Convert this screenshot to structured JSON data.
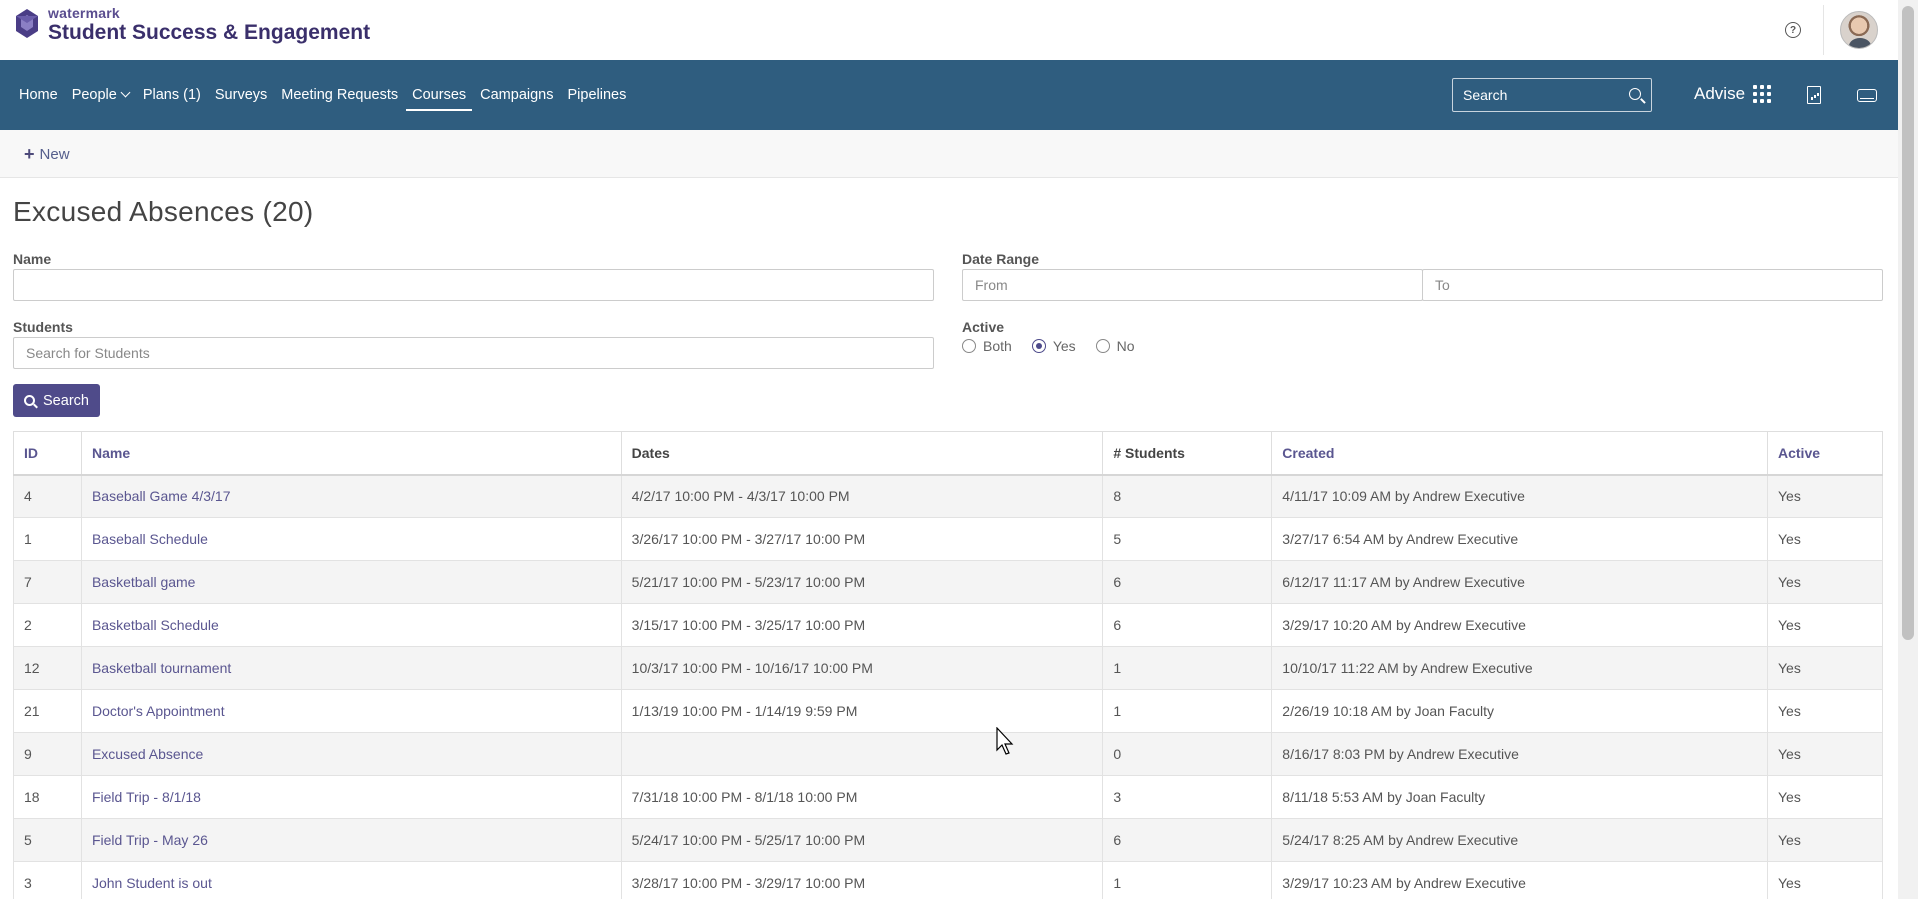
{
  "brand": {
    "small": "watermark",
    "large": "Student Success & Engagement"
  },
  "nav": {
    "items": [
      {
        "label": "Home"
      },
      {
        "label": "People"
      },
      {
        "label": "Plans (1)"
      },
      {
        "label": "Surveys"
      },
      {
        "label": "Meeting Requests"
      },
      {
        "label": "Courses"
      },
      {
        "label": "Campaigns"
      },
      {
        "label": "Pipelines"
      }
    ],
    "active": "Courses",
    "search_placeholder": "Search",
    "advise_label": "Advise"
  },
  "actions": {
    "new_label": "New"
  },
  "page": {
    "title": "Excused Absences (20)"
  },
  "filters": {
    "name_label": "Name",
    "name_value": "",
    "date_range_label": "Date Range",
    "from_placeholder": "From",
    "to_placeholder": "To",
    "students_label": "Students",
    "students_placeholder": "Search for Students",
    "active_label": "Active",
    "active_options": [
      "Both",
      "Yes",
      "No"
    ],
    "active_selected": "Yes",
    "search_button": "Search"
  },
  "table": {
    "headers": [
      "ID",
      "Name",
      "Dates",
      "# Students",
      "Created",
      "Active"
    ],
    "rows": [
      {
        "id": "4",
        "name": "Baseball Game 4/3/17",
        "dates": "4/2/17 10:00 PM - 4/3/17 10:00 PM",
        "students": "8",
        "created": "4/11/17 10:09 AM by Andrew Executive",
        "active": "Yes"
      },
      {
        "id": "1",
        "name": "Baseball Schedule",
        "dates": "3/26/17 10:00 PM - 3/27/17 10:00 PM",
        "students": "5",
        "created": "3/27/17 6:54 AM by Andrew Executive",
        "active": "Yes"
      },
      {
        "id": "7",
        "name": "Basketball game",
        "dates": "5/21/17 10:00 PM - 5/23/17 10:00 PM",
        "students": "6",
        "created": "6/12/17 11:17 AM by Andrew Executive",
        "active": "Yes"
      },
      {
        "id": "2",
        "name": "Basketball Schedule",
        "dates": "3/15/17 10:00 PM - 3/25/17 10:00 PM",
        "students": "6",
        "created": "3/29/17 10:20 AM by Andrew Executive",
        "active": "Yes"
      },
      {
        "id": "12",
        "name": "Basketball tournament",
        "dates": "10/3/17 10:00 PM - 10/16/17 10:00 PM",
        "students": "1",
        "created": "10/10/17 11:22 AM by Andrew Executive",
        "active": "Yes"
      },
      {
        "id": "21",
        "name": "Doctor's Appointment",
        "dates": "1/13/19 10:00 PM - 1/14/19 9:59 PM",
        "students": "1",
        "created": "2/26/19 10:18 AM by Joan Faculty",
        "active": "Yes"
      },
      {
        "id": "9",
        "name": "Excused Absence",
        "dates": "",
        "students": "0",
        "created": "8/16/17 8:03 PM by Andrew Executive",
        "active": "Yes"
      },
      {
        "id": "18",
        "name": "Field Trip - 8/1/18",
        "dates": "7/31/18 10:00 PM - 8/1/18 10:00 PM",
        "students": "3",
        "created": "8/11/18 5:53 AM by Joan Faculty",
        "active": "Yes"
      },
      {
        "id": "5",
        "name": "Field Trip - May 26",
        "dates": "5/24/17 10:00 PM - 5/25/17 10:00 PM",
        "students": "6",
        "created": "5/24/17 8:25 AM by Andrew Executive",
        "active": "Yes"
      },
      {
        "id": "3",
        "name": "John Student is out",
        "dates": "3/28/17 10:00 PM - 3/29/17 10:00 PM",
        "students": "1",
        "created": "3/29/17 10:23 AM by Andrew Executive",
        "active": "Yes"
      }
    ]
  },
  "colors": {
    "nav_bg": "#2f5d7f",
    "accent": "#4f4b8a",
    "link": "#5a5690"
  }
}
